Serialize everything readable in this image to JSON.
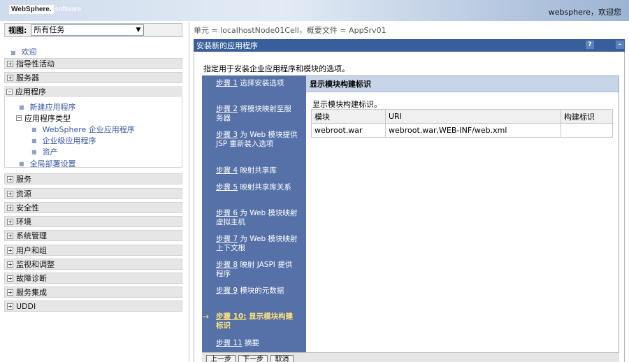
{
  "banner": {
    "logo_box": "WebSphere.",
    "logo_suffix": "software",
    "welcome": "websphere，欢迎您"
  },
  "nav": {
    "view_label": "视图:",
    "view_value": "所有任务",
    "welcome_link": "欢迎",
    "sections": [
      {
        "label": "指导性活动"
      },
      {
        "label": "服务器"
      },
      {
        "label": "应用程序"
      },
      {
        "label": "服务"
      },
      {
        "label": "资源"
      },
      {
        "label": "安全性"
      },
      {
        "label": "环境"
      },
      {
        "label": "系统管理"
      },
      {
        "label": "用户和组"
      },
      {
        "label": "监视和调整"
      },
      {
        "label": "故障诊断"
      },
      {
        "label": "服务集成"
      },
      {
        "label": "UDDI"
      }
    ],
    "app_children": {
      "new_app": "新建应用程序",
      "app_types": "应用程序类型",
      "websphere_apps": "WebSphere 企业应用程序",
      "business_apps": "企业级应用程序",
      "assets": "资产",
      "global_deploy": "全局部署设置"
    }
  },
  "main": {
    "breadcrumb": "单元 = localhostNode01Cell，概要文件 = AppSrv01",
    "title": "安装新的应用程序",
    "help_icon": "?",
    "min_icon": "–",
    "description": "指定用于安装企业应用程序和模块的选项。",
    "steps": [
      {
        "num": "步骤 1",
        "text": "选择安装选项"
      },
      {
        "num": "步骤 2",
        "text": "将模块映射至服务器"
      },
      {
        "num": "步骤 3",
        "text": "为 Web 模块提供 JSP 重新装入选项"
      },
      {
        "num": "步骤 4",
        "text": "映射共享库"
      },
      {
        "num": "步骤 5",
        "text": "映射共享库关系"
      },
      {
        "num": "步骤 6",
        "text": "为 Web 模块映射虚拟主机"
      },
      {
        "num": "步骤 7",
        "text": "为 Web 模块映射上下文根"
      },
      {
        "num": "步骤 8",
        "text": "映射 JASPI 提供程序"
      },
      {
        "num": "步骤 9",
        "text": "模块的元数据"
      },
      {
        "num": "步骤 10:",
        "text": "显示模块构建标识"
      },
      {
        "num": "步骤 11",
        "text": "摘要"
      }
    ],
    "current_arrow": "→",
    "panel_title": "显示模块构建标识",
    "panel_desc": "显示模块构建标识。",
    "table": {
      "headers": [
        "模块",
        "URI",
        "构建标识"
      ],
      "rows": [
        [
          "webroot.war",
          "webroot.war,WEB-INF/web.xml",
          ""
        ]
      ]
    },
    "buttons": {
      "prev": "上一步",
      "next": "下一步",
      "cancel": "取消"
    }
  },
  "colors": {
    "title_bar": "#385f9c",
    "steps_bg": "#5571a8",
    "current_step": "#ffe27a",
    "link": "#3b5aa5"
  }
}
